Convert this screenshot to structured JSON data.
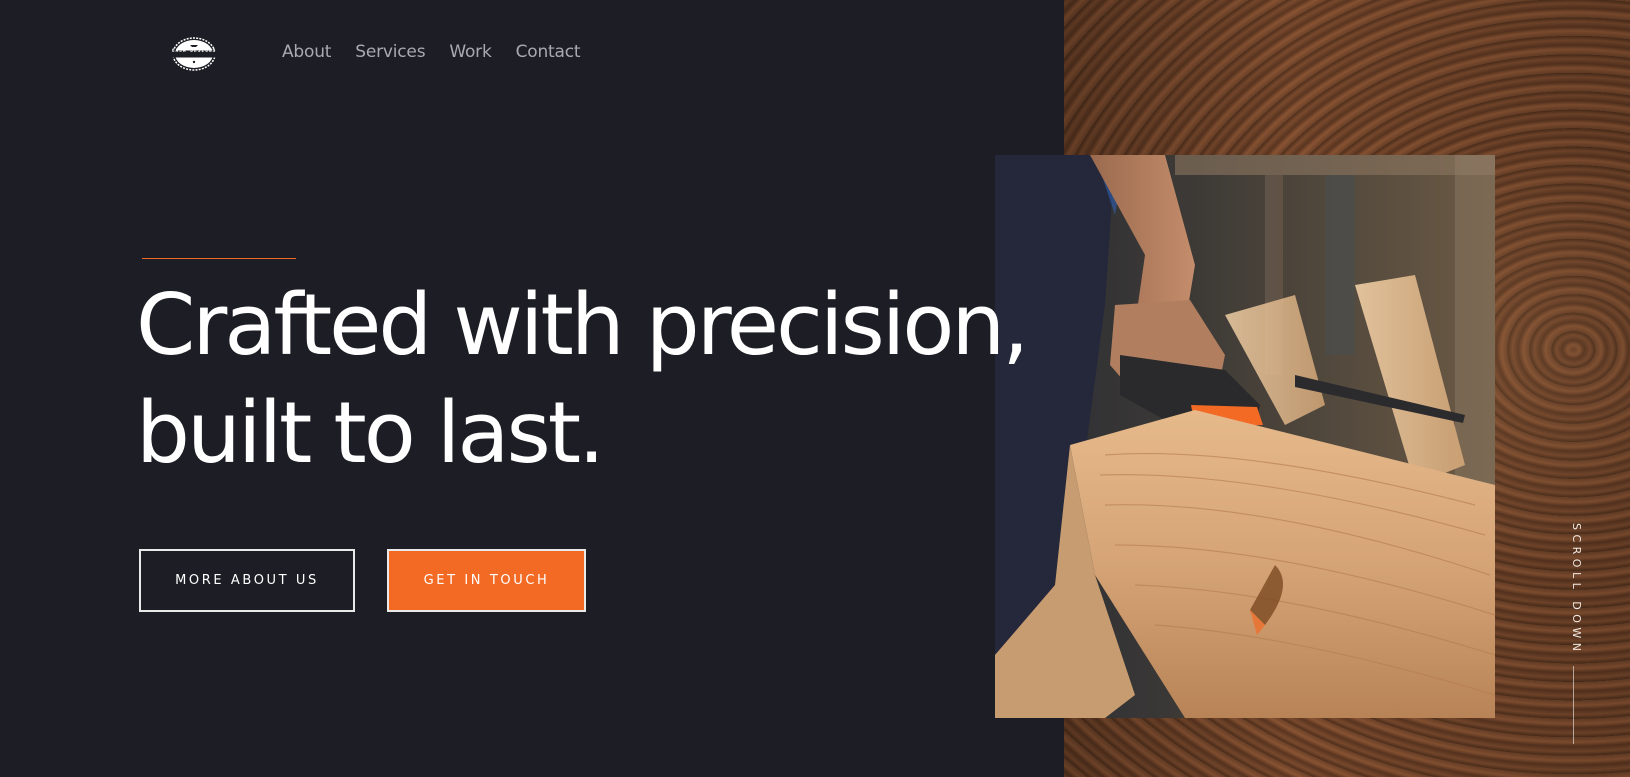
{
  "brand": {
    "logo_text": "CASA DESIGNS",
    "logo_icon": "saw-blade-badge-icon"
  },
  "nav": {
    "items": [
      {
        "label": "About"
      },
      {
        "label": "Services"
      },
      {
        "label": "Work"
      },
      {
        "label": "Contact"
      }
    ]
  },
  "hero": {
    "headline_line1": "Crafted with precision,",
    "headline_line2": "built to last.",
    "primary_cta": "MORE ABOUT US",
    "secondary_cta": "GET IN TOUCH",
    "photo_alt": "Carpenter sanding a wooden plank",
    "scroll_label": "SCROLL DOWN"
  },
  "colors": {
    "background": "#1d1d25",
    "accent": "#f26a24",
    "text": "#ffffff",
    "nav_text": "#a9a9b0"
  }
}
